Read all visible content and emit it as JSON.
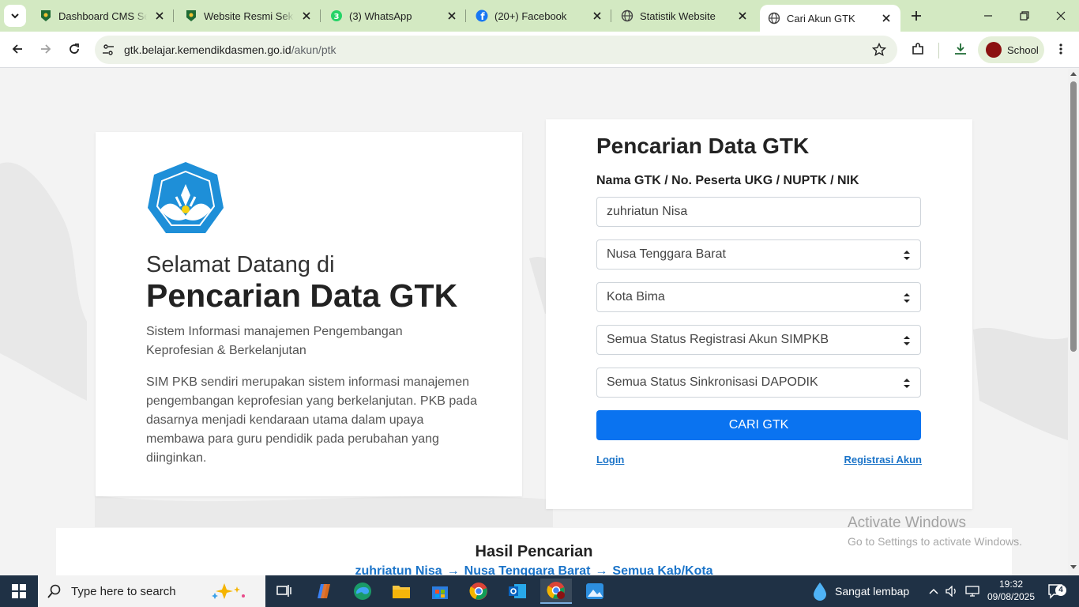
{
  "browser": {
    "tabs": [
      {
        "label": "Dashboard CMS Sekolah",
        "icon": "school-logo-icon"
      },
      {
        "label": "Website Resmi Sekolah",
        "icon": "school-logo-icon"
      },
      {
        "label": "(3) WhatsApp",
        "icon": "whatsapp-icon"
      },
      {
        "label": "(20+) Facebook",
        "icon": "facebook-icon"
      },
      {
        "label": "Statistik Website",
        "icon": "globe-icon"
      },
      {
        "label": "Cari Akun GTK",
        "icon": "globe-icon",
        "active": true
      }
    ],
    "url_domain": "gtk.belajar.kemendikdasmen.go.id",
    "url_path": "/akun/ptk",
    "profile_name": "School"
  },
  "hero": {
    "welcome": "Selamat Datang di",
    "title": "Pencarian Data GTK",
    "subtitle": "Sistem Informasi manajemen Pengembangan Keprofesian & Berkelanjutan",
    "description": "SIM PKB sendiri merupakan sistem informasi manajemen pengembangan keprofesian yang berkelanjutan. PKB pada dasarnya menjadi kendaraan utama dalam upaya membawa para guru pendidik pada perubahan yang diinginkan."
  },
  "form": {
    "title": "Pencarian Data GTK",
    "label": "Nama GTK / No. Peserta UKG / NUPTK / NIK",
    "name_value": "zuhriatun Nisa",
    "province": "Nusa Tenggara Barat",
    "city": "Kota Bima",
    "registration_status": "Semua Status Registrasi Akun SIMPKB",
    "sync_status": "Semua Status Sinkronisasi DAPODIK",
    "search_button": "CARI GTK",
    "login_link": "Login",
    "register_link": "Registrasi Akun"
  },
  "results": {
    "title": "Hasil Pencarian",
    "breadcrumb": [
      "zuhriatun Nisa",
      "Nusa Tenggara Barat",
      "Semua Kab/Kota"
    ],
    "arrow": "→"
  },
  "watermark": {
    "line1": "Activate Windows",
    "line2": "Go to Settings to activate Windows."
  },
  "taskbar": {
    "search_placeholder": "Type here to search",
    "weather": "Sangat lembap",
    "time": "19:32",
    "date": "09/08/2025",
    "notification_count": "4"
  },
  "colors": {
    "primary_button": "#0a73f0",
    "link": "#1a73c8",
    "tabstrip": "#d3e9c2",
    "taskbar": "#1f3145"
  }
}
